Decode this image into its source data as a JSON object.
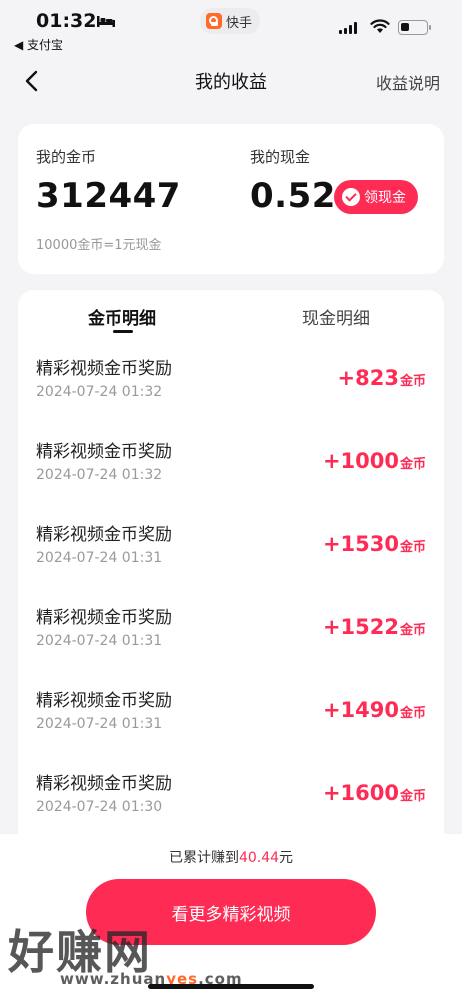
{
  "status_bar": {
    "time": "01:32",
    "back_app": "◀ 支付宝",
    "app_name": "快手",
    "icons": [
      "bed-icon",
      "signal-icon",
      "wifi-icon",
      "battery-icon"
    ]
  },
  "nav": {
    "title": "我的收益",
    "explain": "收益说明"
  },
  "summary": {
    "coins_label": "我的金币",
    "coins_value": "312447",
    "cash_label": "我的现金",
    "cash_value": "0.52",
    "claim_button": "领现金",
    "rate_text": "10000金币=1元现金"
  },
  "tabs": [
    {
      "label": "金币明细",
      "active": true
    },
    {
      "label": "现金明细",
      "active": false
    }
  ],
  "records": [
    {
      "title": "精彩视频金币奖励",
      "time": "2024-07-24 01:32",
      "amount": "+823",
      "unit": "金币"
    },
    {
      "title": "精彩视频金币奖励",
      "time": "2024-07-24 01:32",
      "amount": "+1000",
      "unit": "金币"
    },
    {
      "title": "精彩视频金币奖励",
      "time": "2024-07-24 01:31",
      "amount": "+1530",
      "unit": "金币"
    },
    {
      "title": "精彩视频金币奖励",
      "time": "2024-07-24 01:31",
      "amount": "+1522",
      "unit": "金币"
    },
    {
      "title": "精彩视频金币奖励",
      "time": "2024-07-24 01:31",
      "amount": "+1490",
      "unit": "金币"
    },
    {
      "title": "精彩视频金币奖励",
      "time": "2024-07-24 01:30",
      "amount": "+1600",
      "unit": "金币"
    }
  ],
  "bottom": {
    "earned_prefix": "已累计赚到",
    "earned_amount": "40.44",
    "earned_suffix": "元",
    "watch_button": "看更多精彩视频"
  },
  "watermark": {
    "text": "好赚网",
    "url_prefix": "www.zhuan",
    "url_accent": "yes",
    "url_suffix": ".com"
  },
  "colors": {
    "accent": "#fe2c55",
    "background": "#f4f4f6",
    "card": "#ffffff"
  }
}
